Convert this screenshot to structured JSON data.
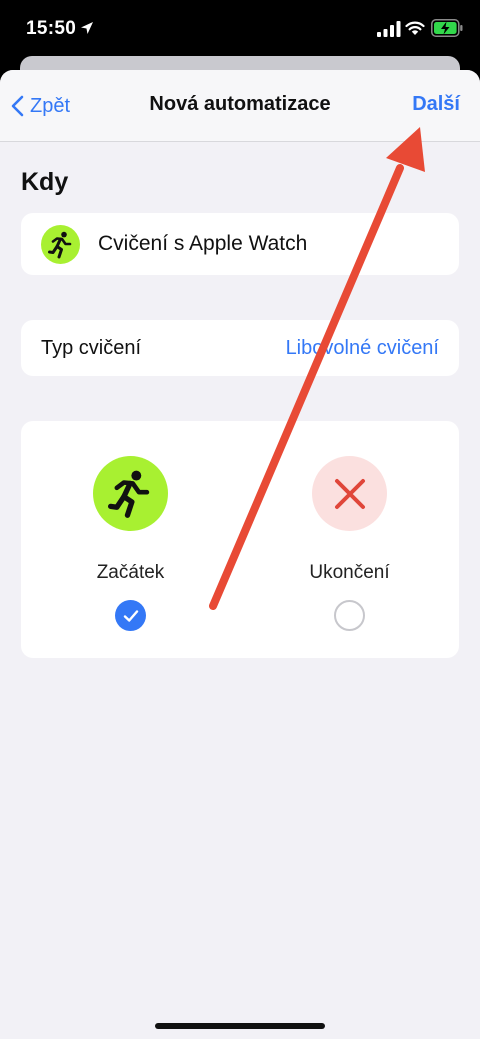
{
  "status_bar": {
    "time": "15:50",
    "icons": [
      "location-arrow-icon",
      "cellular-signal-icon",
      "wifi-icon",
      "battery-charging-icon"
    ]
  },
  "nav": {
    "back_label": "Zpět",
    "title": "Nová automatizace",
    "next_label": "Další"
  },
  "section": {
    "title": "Kdy"
  },
  "trigger": {
    "icon": "running-figure-icon",
    "label": "Cvičení s Apple Watch"
  },
  "workout_type": {
    "label": "Typ cvičení",
    "value": "Libovolné cvičení"
  },
  "options": [
    {
      "label": "Začátek",
      "icon": "running-figure-icon",
      "selected": true
    },
    {
      "label": "Ukončení",
      "icon": "close-x-icon",
      "selected": false
    }
  ],
  "colors": {
    "accent": "#3478f6",
    "activity_green": "#a8f031",
    "end_red": "#e0463a",
    "end_red_bg": "#fbe0df",
    "annotation_arrow": "#e84a35"
  }
}
